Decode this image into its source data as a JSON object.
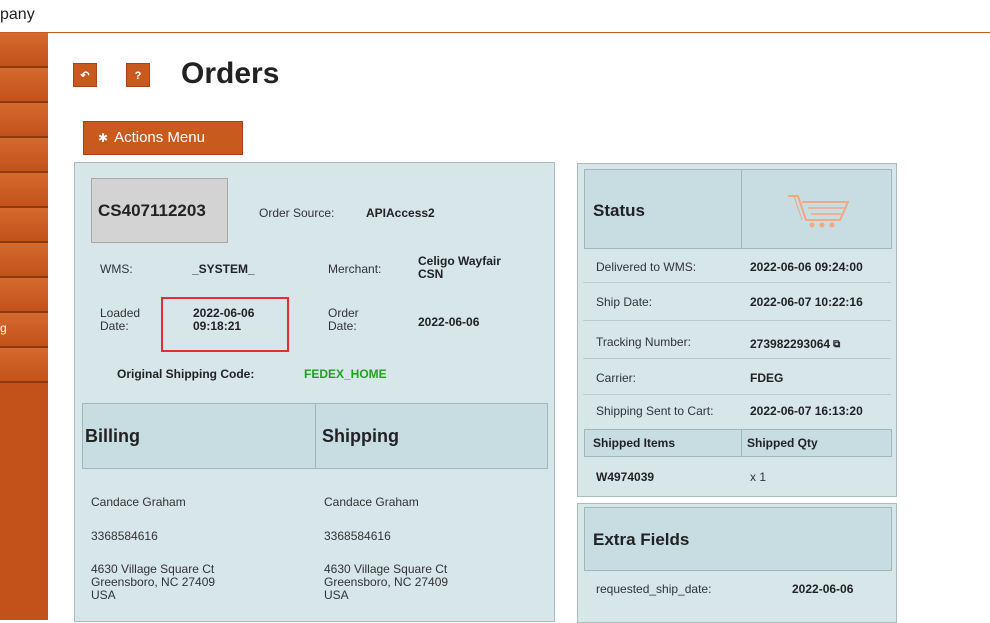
{
  "app": {
    "company_label": "pany"
  },
  "toolbar": {
    "back_icon": "↶",
    "help_label": "?",
    "page_title": "Orders",
    "actions_label": "Actions Menu",
    "actions_icon": "✱"
  },
  "sidebar": {
    "partial_label": "g"
  },
  "order": {
    "id": "CS407112203",
    "order_source_label": "Order Source:",
    "order_source_value": "APIAccess2",
    "wms_label": "WMS:",
    "wms_value": "_SYSTEM_",
    "merchant_label": "Merchant:",
    "merchant_value_1": "Celigo Wayfair",
    "merchant_value_2": "CSN",
    "loaded_label_1": "Loaded",
    "loaded_label_2": "Date:",
    "loaded_value_1": "2022-06-06",
    "loaded_value_2": "09:18:21",
    "order_date_label_1": "Order",
    "order_date_label_2": "Date:",
    "order_date_value": "2022-06-06",
    "orig_ship_label": "Original Shipping Code:",
    "orig_ship_value": "FEDEX_HOME"
  },
  "billing": {
    "header": "Billing",
    "name": "Candace Graham",
    "phone": "3368584616",
    "addr1": "4630 Village Square Ct",
    "addr2": "Greensboro, NC 27409",
    "addr3": "USA"
  },
  "shipping": {
    "header": "Shipping",
    "name": "Candace Graham",
    "phone": "3368584616",
    "addr1": "4630 Village Square Ct",
    "addr2": "Greensboro, NC 27409",
    "addr3": "USA"
  },
  "status": {
    "header": "Status",
    "icon": "shopping-cart-icon",
    "delivered_label": "Delivered to WMS:",
    "delivered_value": "2022-06-06 09:24:00",
    "ship_date_label": "Ship Date:",
    "ship_date_value": "2022-06-07 10:22:16",
    "tracking_label": "Tracking Number:",
    "tracking_value": "273982293064",
    "carrier_label": "Carrier:",
    "carrier_value": "FDEG",
    "sent_label": "Shipping Sent to Cart:",
    "sent_value": "2022-06-07 16:13:20",
    "items_header": "Shipped Items",
    "qty_header": "Shipped Qty",
    "item_sku": "W4974039",
    "item_qty": "x 1"
  },
  "extra": {
    "header": "Extra Fields",
    "field1_label": "requested_ship_date:",
    "field1_value": "2022-06-06"
  },
  "colors": {
    "accent": "#c85a1e",
    "panel": "#d6e6e9",
    "highlight": "#e03030",
    "ship_code": "#22a022"
  }
}
